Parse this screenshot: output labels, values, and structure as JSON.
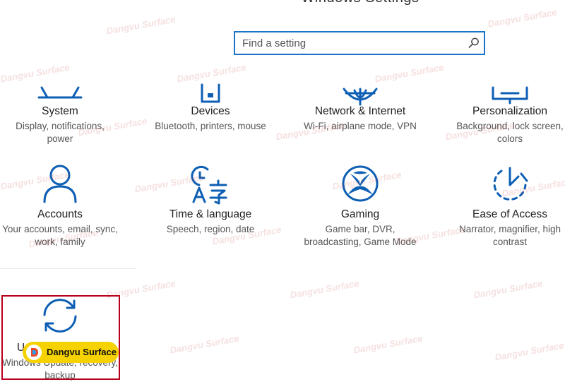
{
  "window": {
    "title": "Windows Settings"
  },
  "search": {
    "placeholder": "Find a setting",
    "icon": "search-icon"
  },
  "accent_color": "#0e5fb4",
  "tiles": [
    {
      "name": "System",
      "desc_lines": [
        "Display, notifications,",
        "power"
      ],
      "icon": "laptop-icon"
    },
    {
      "name": "Devices",
      "desc_lines": [
        "Bluetooth, printers, mouse"
      ],
      "icon": "keyboard-icon"
    },
    {
      "name": "Network & Internet",
      "desc_lines": [
        "Wi-Fi, airplane mode, VPN"
      ],
      "icon": "globe-icon"
    },
    {
      "name": "Personalization",
      "desc_lines": [
        "Background, lock screen,",
        "colors"
      ],
      "icon": "paintbrush-icon"
    },
    {
      "name": "Accounts",
      "desc_lines": [
        "Your accounts, email, sync,",
        "work, family"
      ],
      "icon": "person-icon"
    },
    {
      "name": "Time & language",
      "desc_lines": [
        "Speech, region, date"
      ],
      "icon": "time-language-icon"
    },
    {
      "name": "Gaming",
      "desc_lines": [
        "Game bar, DVR,",
        "broadcasting, Game Mode"
      ],
      "icon": "xbox-icon"
    },
    {
      "name": "Ease of Access",
      "desc_lines": [
        "Narrator, magnifier, high",
        "contrast"
      ],
      "icon": "ease-of-access-icon"
    },
    {
      "name": "Update & security",
      "desc_lines": [
        "Windows Update, recovery,",
        "backup"
      ],
      "icon": "sync-icon"
    }
  ],
  "watermark": {
    "text": "Dangvu Surface"
  },
  "badge": {
    "text": "Dangvu Surface",
    "color": "#f5d200"
  },
  "highlight_color": "#b8001c"
}
